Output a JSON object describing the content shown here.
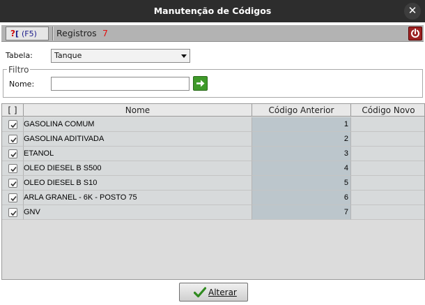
{
  "window": {
    "title": "Manutenção de Códigos",
    "close_glyph": "✕"
  },
  "toolbar": {
    "help_symbol": "?",
    "help_bracket": "[",
    "help_shortcut": "(F5)",
    "registros_label": "Registros",
    "registros_count": "7",
    "power_icon": "power-icon"
  },
  "form": {
    "tabela_label": "Tabela:",
    "tabela_value": "Tanque",
    "filtro_title": "Filtro",
    "nome_label": "Nome:",
    "nome_value": ""
  },
  "grid": {
    "headers": [
      "[ ]",
      "Nome",
      "Código Anterior",
      "Código Novo"
    ],
    "rows": [
      {
        "checked": true,
        "nome": "GASOLINA COMUM",
        "codigo_anterior": "1",
        "codigo_novo": ""
      },
      {
        "checked": true,
        "nome": "GASOLINA ADITIVADA",
        "codigo_anterior": "2",
        "codigo_novo": ""
      },
      {
        "checked": true,
        "nome": "ETANOL",
        "codigo_anterior": "3",
        "codigo_novo": ""
      },
      {
        "checked": true,
        "nome": "OLEO DIESEL B S500",
        "codigo_anterior": "4",
        "codigo_novo": ""
      },
      {
        "checked": true,
        "nome": "OLEO DIESEL B S10",
        "codigo_anterior": "5",
        "codigo_novo": ""
      },
      {
        "checked": true,
        "nome": "ARLA GRANEL - 6K - POSTO 75",
        "codigo_anterior": "6",
        "codigo_novo": ""
      },
      {
        "checked": true,
        "nome": "GNV",
        "codigo_anterior": "7",
        "codigo_novo": ""
      }
    ]
  },
  "footer": {
    "alterar_label": "Alterar"
  },
  "colors": {
    "accent_green": "#3f9a2a",
    "count_red": "#e01010",
    "column_highlight": "#bcc6cc"
  }
}
